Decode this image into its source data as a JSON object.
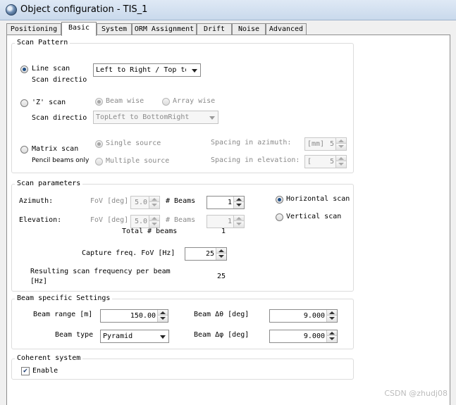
{
  "window": {
    "title": "Object configuration - TIS_1",
    "icon": "globe-icon"
  },
  "tabs": [
    {
      "label": "Positioning"
    },
    {
      "label": "Basic",
      "active": true
    },
    {
      "label": "System"
    },
    {
      "label": "ORM Assignment"
    },
    {
      "label": "Drift"
    },
    {
      "label": "Noise"
    },
    {
      "label": "Advanced"
    }
  ],
  "scan_pattern": {
    "legend": "Scan Pattern",
    "line_scan": {
      "label": "Line scan",
      "selected": true,
      "direction_label": "Scan directio",
      "direction_value": "Left to Right / Top to"
    },
    "z_scan": {
      "label": "'Z' scan",
      "selected": false,
      "beam_wise": "Beam wise",
      "array_wise": "Array wise",
      "direction_label": "Scan directio",
      "direction_value": "TopLeft to BottomRight"
    },
    "matrix_scan": {
      "label": "Matrix scan",
      "note": "Pencil beams only",
      "single_source": "Single source",
      "multiple_source": "Multiple source",
      "spacing_azimuth_label": "Spacing in azimuth:",
      "spacing_azimuth_unit": "[mm]",
      "spacing_azimuth_value": "5",
      "spacing_elevation_label": "Spacing in elevation:",
      "spacing_elevation_unit": "[",
      "spacing_elevation_value": "5"
    }
  },
  "scan_parameters": {
    "legend": "Scan parameters",
    "azimuth_label": "Azimuth:",
    "elevation_label": "Elevation:",
    "fov_label": "FoV [deg]",
    "azimuth_fov_value": "5.0",
    "elevation_fov_value": "5.0",
    "beams_label": "# Beams",
    "azimuth_beams": "1",
    "elevation_beams": "1",
    "total_beams_label": "Total # beams",
    "total_beams_value": "1",
    "horizontal_scan": "Horizontal scan",
    "vertical_scan": "Vertical scan",
    "capture_freq_label": "Capture freq. FoV [Hz]",
    "capture_freq_value": "25",
    "resulting_label_line1": "Resulting scan frequency per beam",
    "resulting_label_line2": "[Hz]",
    "resulting_value": "25"
  },
  "beam_settings": {
    "legend": "Beam specific Settings",
    "beam_range_label": "Beam range [m]",
    "beam_range_value": "150.00",
    "beam_type_label": "Beam type",
    "beam_type_value": "Pyramid",
    "beam_theta_label": "Beam  Δθ [deg]",
    "beam_theta_value": "9.000",
    "beam_phi_label": "Beam  Δφ [deg]",
    "beam_phi_value": "9.000"
  },
  "coherent": {
    "legend": "Coherent system",
    "enable_label": "Enable",
    "enable_checked": true
  },
  "watermark": "CSDN @zhudj08"
}
